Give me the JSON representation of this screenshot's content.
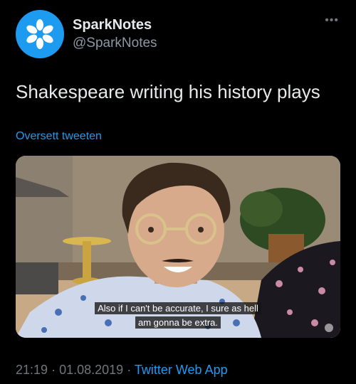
{
  "tweet": {
    "display_name": "SparkNotes",
    "handle": "@SparkNotes",
    "more_label": "•••",
    "text": "Shakespeare writing his history plays",
    "translate_label": "Oversett tweeten",
    "media": {
      "subtitle_line1": "Also if I can't be accurate, I sure as hell",
      "subtitle_line2": "am gonna be extra."
    },
    "time": "21:19",
    "date": "01.08.2019",
    "separator": "·",
    "source_app": "Twitter Web App"
  },
  "icons": {
    "avatar": "sparknotes-logo-icon",
    "more": "more-options-icon"
  },
  "colors": {
    "accent": "#1d9bf0",
    "background": "#000000",
    "secondary_text": "#71767b"
  }
}
